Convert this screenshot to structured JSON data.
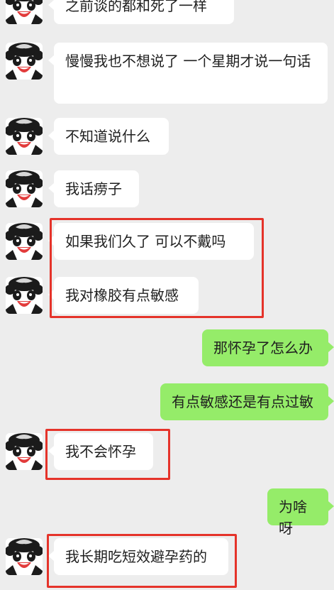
{
  "conversation": {
    "messages": [
      {
        "from": "other",
        "text": "之前谈的都和死了一样"
      },
      {
        "from": "other",
        "text": "慢慢我也不想说了 一个星期才说一句话"
      },
      {
        "from": "other",
        "text": "不知道说什么"
      },
      {
        "from": "other",
        "text": "我话痨子"
      },
      {
        "from": "other",
        "text": "如果我们久了 可以不戴吗"
      },
      {
        "from": "other",
        "text": "我对橡胶有点敏感"
      },
      {
        "from": "me",
        "text": "那怀孕了怎么办"
      },
      {
        "from": "me",
        "text": "有点敏感还是有点过敏"
      },
      {
        "from": "other",
        "text": "我不会怀孕"
      },
      {
        "from": "me",
        "text": "为啥呀"
      },
      {
        "from": "other",
        "text": "我长期吃短效避孕药的"
      }
    ]
  },
  "colors": {
    "background": "#ededed",
    "incoming_bubble": "#ffffff",
    "outgoing_bubble": "#95ec69",
    "highlight_box": "#e5332a"
  },
  "icons": {
    "avatar": "panda-avatar-icon"
  }
}
